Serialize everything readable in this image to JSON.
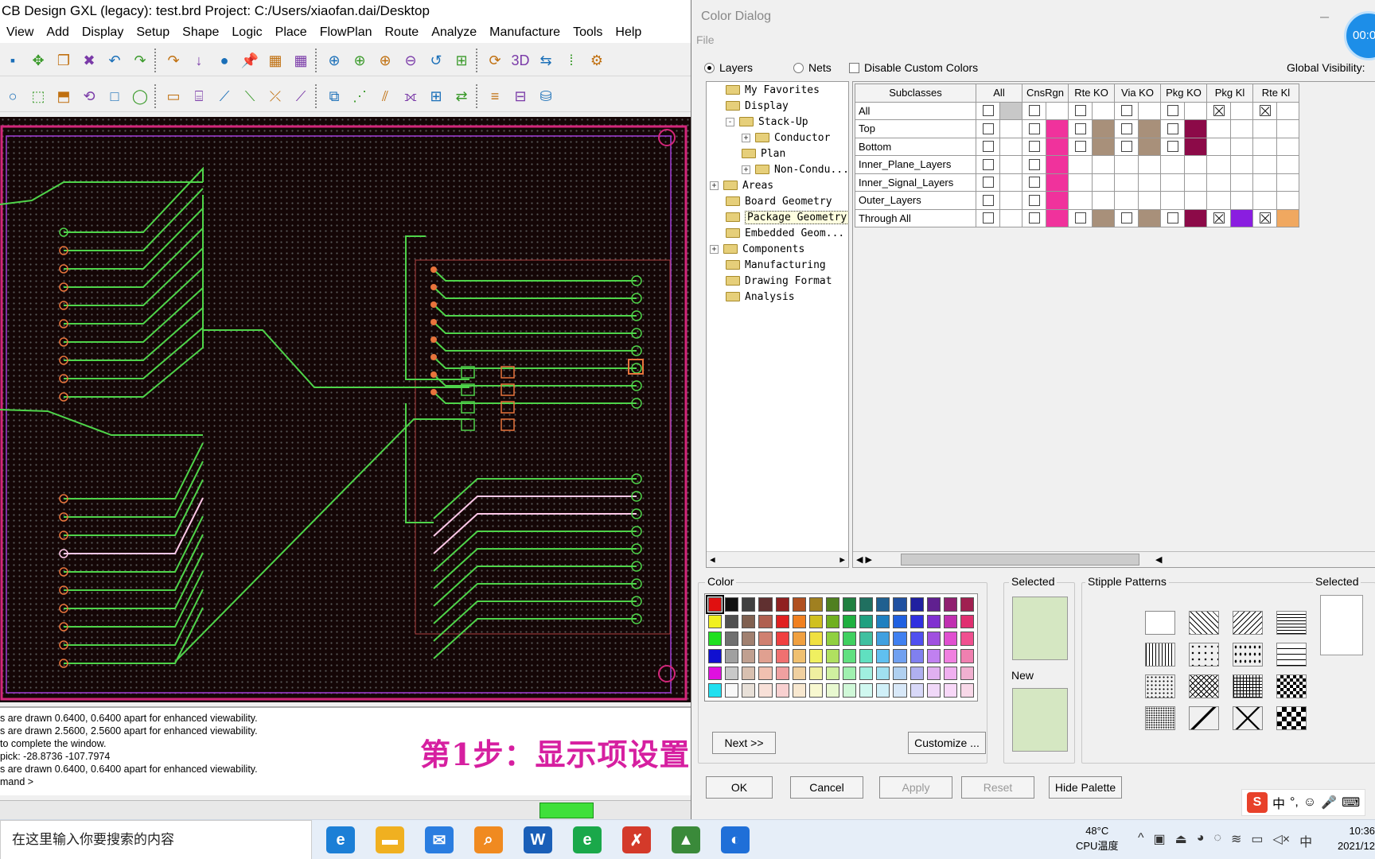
{
  "main_window": {
    "title": "CB Design GXL (legacy): test.brd  Project: C:/Users/xiaofan.dai/Desktop",
    "menu": [
      "View",
      "Add",
      "Display",
      "Setup",
      "Shape",
      "Logic",
      "Place",
      "FlowPlan",
      "Route",
      "Analyze",
      "Manufacture",
      "Tools",
      "Help"
    ],
    "toolbar1_icons": [
      "save-icon",
      "move-icon",
      "copy-icon",
      "delete-icon",
      "undo-icon",
      "redo-icon",
      "redo-forward-icon",
      "down-icon",
      "ratsnest-icon",
      "pin-icon",
      "grid-toggle-icon",
      "grid-icon",
      "zoom-fit-icon",
      "zoom-window-icon",
      "zoom-in-icon",
      "zoom-out-icon",
      "zoom-previous-icon",
      "zoom-world-icon",
      "refresh-icon",
      "3d-view-icon",
      "flip-icon",
      "grid-dots-icon",
      "settings-icon"
    ],
    "toolbar2_icons": [
      "circle-select-icon",
      "select-icon",
      "shape-icon",
      "rotate-icon",
      "rect-icon",
      "oval-icon",
      "text-icon",
      "component-icon",
      "add-connect-icon",
      "slide-icon",
      "delete-connect-icon",
      "vertex-icon",
      "glossing-icon",
      "spread-icon",
      "bus-icon",
      "fanout-icon",
      "place-icon",
      "swap-icon",
      "align-icon",
      "spread-components-icon",
      "odb-icon"
    ],
    "console_lines": [
      "s are drawn 0.6400, 0.6400 apart for enhanced viewability.",
      "s are drawn 2.5600, 2.5600 apart for enhanced viewability.",
      " to complete the window.",
      "pick:  -28.8736  -107.7974",
      "s are drawn 0.6400, 0.6400 apart for enhanced viewability.",
      "mand >"
    ],
    "overlay_caption": "第1步：显示项设置",
    "colors": {
      "trace": "#4fd44a",
      "board_outline": "#d3267a",
      "pad": "#e8743c",
      "highlight": "#ffc8e8"
    }
  },
  "dialog": {
    "title": "Color Dialog",
    "menu_file": "File",
    "timer": "00:0",
    "radio_layers": "Layers",
    "radio_nets": "Nets",
    "disable_custom": "Disable Custom Colors",
    "global_visibility": "Global Visibility:",
    "tree": [
      {
        "label": "My Favorites",
        "expander": ""
      },
      {
        "label": "Display",
        "expander": ""
      },
      {
        "label": "Stack-Up",
        "expander": "-"
      },
      {
        "label": "Conductor",
        "expander": "+"
      },
      {
        "label": "Plan",
        "expander": ""
      },
      {
        "label": "Non-Condu...",
        "expander": "+"
      },
      {
        "label": "Areas",
        "expander": "+"
      },
      {
        "label": "Board Geometry",
        "expander": ""
      },
      {
        "label": "Package Geometry",
        "expander": "",
        "selected": true
      },
      {
        "label": "Embedded Geom...",
        "expander": ""
      },
      {
        "label": "Components",
        "expander": "+"
      },
      {
        "label": "Manufacturing",
        "expander": ""
      },
      {
        "label": "Drawing Format",
        "expander": ""
      },
      {
        "label": "Analysis",
        "expander": ""
      }
    ],
    "columns": [
      "Subclasses",
      "All",
      "CnsRgn",
      "Rte KO",
      "Via KO",
      "Pkg KO",
      "Pkg Kl",
      "Rte Kl"
    ],
    "rows": [
      {
        "name": "All",
        "cells": [
          [
            "",
            "#c8c8c8"
          ],
          [
            "",
            ""
          ],
          [
            "",
            ""
          ],
          [
            "",
            ""
          ],
          [
            "",
            ""
          ],
          [
            "x",
            ""
          ],
          [
            "x",
            ""
          ]
        ]
      },
      {
        "name": "Top",
        "cells": [
          [
            "",
            ""
          ],
          [
            "",
            "#f0329c"
          ],
          [
            "",
            "#a8907a"
          ],
          [
            "",
            "#a8907a"
          ],
          [
            "",
            "#8c0a48"
          ],
          [
            "-",
            ""
          ],
          [
            "-",
            ""
          ]
        ]
      },
      {
        "name": "Bottom",
        "cells": [
          [
            "",
            ""
          ],
          [
            "",
            "#f0329c"
          ],
          [
            "",
            "#a8907a"
          ],
          [
            "",
            "#a8907a"
          ],
          [
            "",
            "#8c0a48"
          ],
          [
            "-",
            ""
          ],
          [
            "-",
            ""
          ]
        ]
      },
      {
        "name": "Inner_Plane_Layers",
        "cells": [
          [
            "",
            ""
          ],
          [
            "",
            "#f0329c"
          ],
          [
            "-",
            ""
          ],
          [
            "-",
            ""
          ],
          [
            "-",
            ""
          ],
          [
            "-",
            ""
          ],
          [
            "-",
            ""
          ]
        ]
      },
      {
        "name": "Inner_Signal_Layers",
        "cells": [
          [
            "",
            ""
          ],
          [
            "",
            "#f0329c"
          ],
          [
            "-",
            ""
          ],
          [
            "-",
            ""
          ],
          [
            "-",
            ""
          ],
          [
            "-",
            ""
          ],
          [
            "-",
            ""
          ]
        ]
      },
      {
        "name": "Outer_Layers",
        "cells": [
          [
            "",
            ""
          ],
          [
            "",
            "#f0329c"
          ],
          [
            "-",
            ""
          ],
          [
            "-",
            ""
          ],
          [
            "-",
            ""
          ],
          [
            "-",
            ""
          ],
          [
            "-",
            ""
          ]
        ]
      },
      {
        "name": "Through All",
        "cells": [
          [
            "",
            ""
          ],
          [
            "",
            "#f0329c"
          ],
          [
            "",
            "#a8907a"
          ],
          [
            "",
            "#a8907a"
          ],
          [
            "",
            "#8c0a48"
          ],
          [
            "x",
            "#8a1ee0"
          ],
          [
            "x",
            "#f0a860"
          ]
        ]
      }
    ],
    "color_group": "Color",
    "selected_label": "Selected",
    "new_label": "New",
    "stipple_label": "Stipple Patterns",
    "stipple_selected": "Selected",
    "next_btn": "Next >>",
    "customize_btn": "Customize ...",
    "ok_btn": "OK",
    "cancel_btn": "Cancel",
    "apply_btn": "Apply",
    "reset_btn": "Reset",
    "hide_btn": "Hide Palette",
    "preview_color": "#d5e7c2",
    "palette": [
      "#e01010",
      "#101010",
      "#404040",
      "#603030",
      "#902020",
      "#b05020",
      "#a08020",
      "#508020",
      "#208040",
      "#207060",
      "#206090",
      "#2050a0",
      "#2020a0",
      "#602090",
      "#902070",
      "#a02050",
      "#f0f020",
      "#505050",
      "#806050",
      "#b06050",
      "#e02020",
      "#f08020",
      "#d0c020",
      "#70b020",
      "#20b040",
      "#20a080",
      "#2080c0",
      "#2060e0",
      "#3030e0",
      "#8030d0",
      "#c030b0",
      "#e03070",
      "#20e020",
      "#707070",
      "#a08070",
      "#d08070",
      "#f04040",
      "#f0a040",
      "#f0e040",
      "#90d040",
      "#40d060",
      "#40c0a0",
      "#40a0e0",
      "#4080f0",
      "#5050f0",
      "#a050e0",
      "#e050d0",
      "#f05090",
      "#1010d0",
      "#a0a0a0",
      "#c0a090",
      "#e0a090",
      "#f07070",
      "#f0c070",
      "#f0f060",
      "#b0e060",
      "#60e080",
      "#60e0c0",
      "#60c0f0",
      "#70a0f0",
      "#8080f0",
      "#c080f0",
      "#f080e0",
      "#f080b0",
      "#e010e0",
      "#c8c8c8",
      "#d8c0b0",
      "#f0c0b0",
      "#f0a0a0",
      "#f0d0a0",
      "#f0f0a0",
      "#d0f0a0",
      "#a0f0b0",
      "#a0f0e0",
      "#a0e0f0",
      "#b0d0f0",
      "#b0b0f0",
      "#e0b0f0",
      "#f0b0f0",
      "#f0b0d0",
      "#20e0f0",
      "#f8f8f8",
      "#e8e0d8",
      "#f8e0d8",
      "#f8d0d0",
      "#f8e8d0",
      "#f8f8d0",
      "#e8f8d0",
      "#d0f8d8",
      "#d0f8f0",
      "#d0f0f8",
      "#d8e8f8",
      "#d8d8f8",
      "#f0d8f8",
      "#f8d8f8",
      "#f8d8e8"
    ],
    "stipple_patterns": [
      "blank-pattern",
      "diag-left-pattern",
      "diag-right-pattern",
      "horizontal-pattern",
      "vertical-pattern",
      "dots-pattern",
      "plus-pattern",
      "dash-pattern",
      "sparse-dots-pattern",
      "crosshatch-pattern",
      "grid-pattern",
      "checker-pattern",
      "fine-dots-pattern",
      "diamond-pattern",
      "x-pattern",
      "dense-checker-pattern"
    ]
  },
  "ime": {
    "chinese": "中"
  },
  "taskbar": {
    "search_placeholder": "在这里输入你要搜索的内容",
    "temperature": "48°C",
    "temp_label": "CPU温度",
    "time": "10:36",
    "date": "2021/12",
    "input_lang": "中",
    "apps": [
      "edge-icon",
      "folder-icon",
      "app-icon",
      "search-app-icon",
      "word-icon",
      "ie-icon",
      "pcb-editor-icon",
      "chart-app-icon",
      "browser-icon"
    ]
  }
}
